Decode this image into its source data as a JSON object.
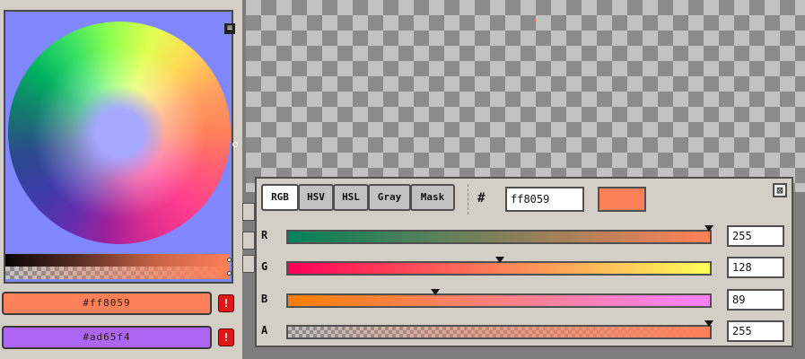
{
  "palette": {
    "primary_hex": "#ff8059",
    "secondary_hex": "#ad65f4",
    "warning_glyph": "!"
  },
  "colors": {
    "primary": "#ff8059",
    "secondary": "#ad65f4",
    "panel_bg": "#d4cfc6",
    "wheel_bg": "#8087ff"
  },
  "icons": {
    "menu": "menu-icon",
    "warning": "warning-icon",
    "close": "close-icon"
  },
  "color_dialog": {
    "modes": [
      "RGB",
      "HSV",
      "HSL",
      "Gray",
      "Mask"
    ],
    "active_mode": "RGB",
    "hash_label": "#",
    "hex_value": "ff8059",
    "close_glyph": "⊠",
    "channels": [
      {
        "label": "R",
        "value": "255",
        "fraction": 1.0
      },
      {
        "label": "G",
        "value": "128",
        "fraction": 0.502
      },
      {
        "label": "B",
        "value": "89",
        "fraction": 0.349
      },
      {
        "label": "A",
        "value": "255",
        "fraction": 1.0
      }
    ]
  }
}
